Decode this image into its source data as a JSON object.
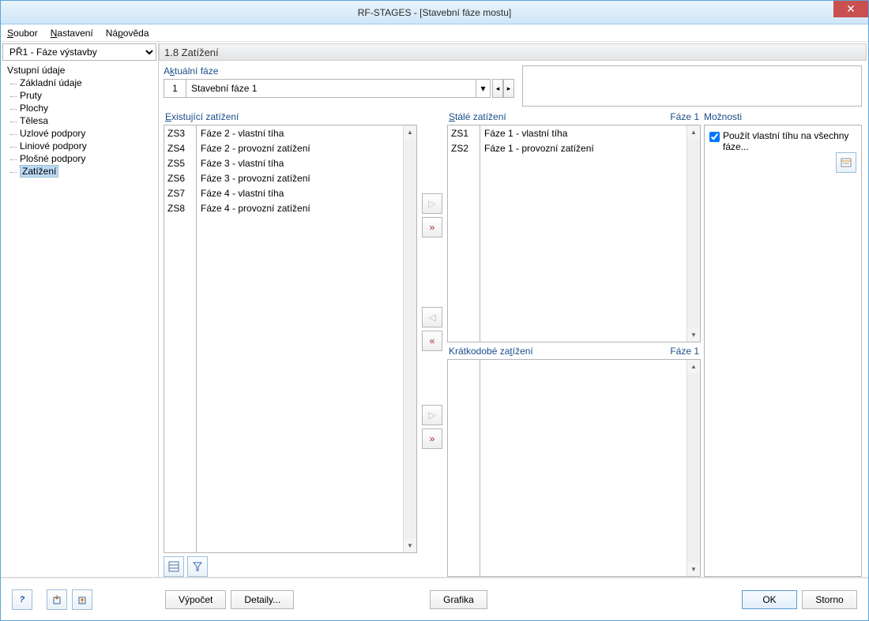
{
  "title": "RF-STAGES - [Stavební fáze mostu]",
  "menu": {
    "soubor": "Soubor",
    "nastaveni": "Nastavení",
    "napoveda": "Nápověda"
  },
  "sidebar": {
    "dropdown": "PŘ1 - Fáze výstavby",
    "root": "Vstupní údaje",
    "items": [
      "Základní údaje",
      "Pruty",
      "Plochy",
      "Tělesa",
      "Uzlové podpory",
      "Liniové podpory",
      "Plošné podpory",
      "Zatížení"
    ],
    "selected_index": 7
  },
  "main_header": "1.8 Zatížení",
  "phase": {
    "label": "Aktuální fáze",
    "num": "1",
    "text": "Stavební fáze 1"
  },
  "existing": {
    "label": "Existující zatížení",
    "rows": [
      {
        "id": "ZS3",
        "desc": "Fáze 2 - vlastní tíha"
      },
      {
        "id": "ZS4",
        "desc": "Fáze 2 - provozní zatížení"
      },
      {
        "id": "ZS5",
        "desc": "Fáze 3 - vlastní tíha"
      },
      {
        "id": "ZS6",
        "desc": "Fáze 3 - provozní zatížení"
      },
      {
        "id": "ZS7",
        "desc": "Fáze 4 - vlastní tíha"
      },
      {
        "id": "ZS8",
        "desc": "Fáze 4 - provozní zatížení"
      }
    ]
  },
  "permanent": {
    "label": "Stálé zatížení",
    "phase": "Fáze 1",
    "rows": [
      {
        "id": "ZS1",
        "desc": "Fáze 1 - vlastní tíha"
      },
      {
        "id": "ZS2",
        "desc": "Fáze 1 - provozní zatížení"
      }
    ]
  },
  "shortterm": {
    "label": "Krátkodobé zatížení",
    "phase": "Fáze 1",
    "rows": []
  },
  "options": {
    "label": "Možnosti",
    "checkbox": "Použít vlastní tíhu na všechny fáze...",
    "checked": true
  },
  "buttons": {
    "vypocet": "Výpočet",
    "detaily": "Detaily...",
    "grafika": "Grafika",
    "ok": "OK",
    "storno": "Storno"
  },
  "glyphs": {
    "right": "▷",
    "right_all": "»",
    "left": "◁",
    "left_all": "«",
    "prev": "◂",
    "next": "▸",
    "dd": "▾",
    "up": "▲",
    "dn": "▼",
    "help": "?",
    "filter": "▼"
  }
}
